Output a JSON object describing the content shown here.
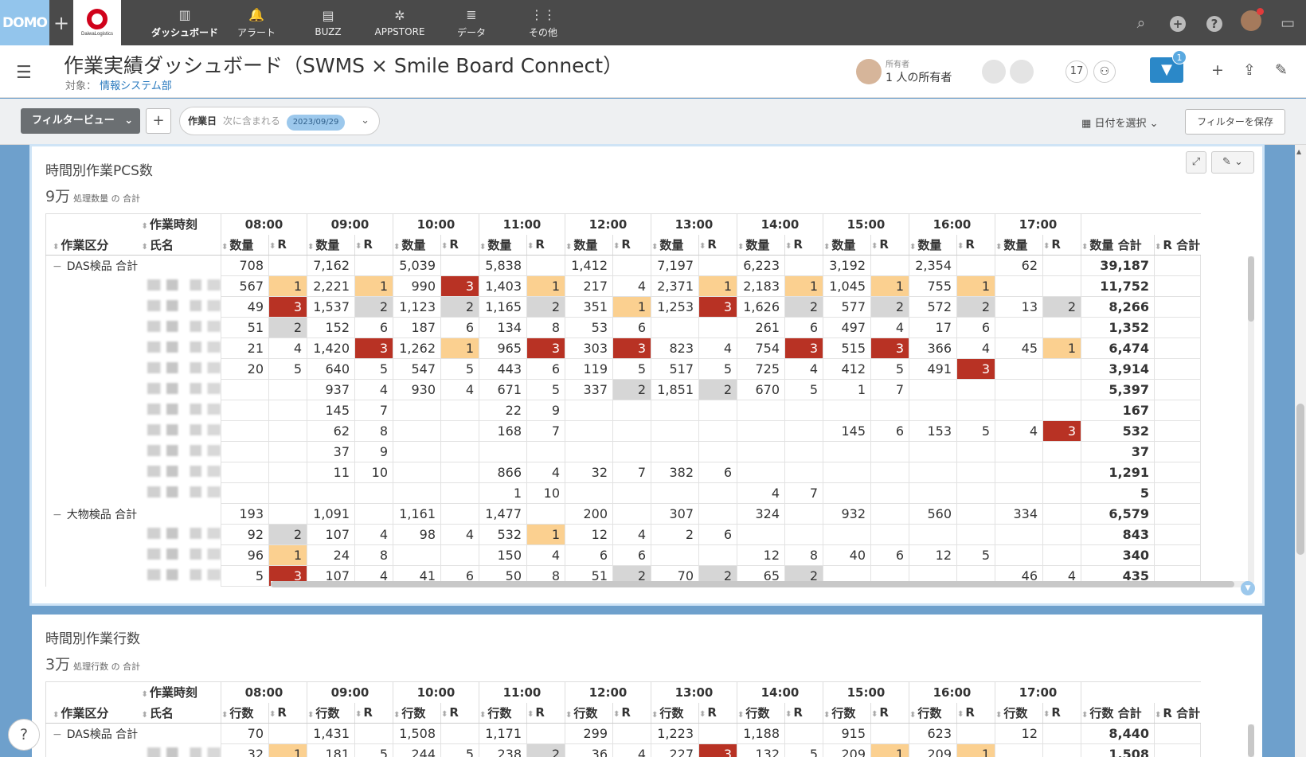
{
  "nav": {
    "logo": "DOMO",
    "brand": "DaiwaLogistics",
    "items": [
      {
        "label": "ダッシュボード",
        "icon": "dashboard-icon",
        "glyph": "▥"
      },
      {
        "label": "アラート",
        "icon": "bell-icon",
        "glyph": "🔔"
      },
      {
        "label": "BUZZ",
        "icon": "chat-icon",
        "glyph": "▤"
      },
      {
        "label": "APPSTORE",
        "icon": "appstore-icon",
        "glyph": "✲"
      },
      {
        "label": "データ",
        "icon": "database-icon",
        "glyph": "≣"
      },
      {
        "label": "その他",
        "icon": "grid-icon",
        "glyph": "⋮⋮"
      }
    ]
  },
  "header": {
    "title": "作業実績ダッシュボード（SWMS × Smile Board Connect）",
    "subtitle_prefix": "対象：",
    "subtitle_link": "情報システム部",
    "owner_label": "所有者",
    "owner_count": "1 人の所有者",
    "share_count": "17",
    "filter_badge": "1"
  },
  "filterbar": {
    "view_label": "フィルタービュー",
    "field": "作業日",
    "operator": "次に含まれる",
    "value": "2023/09/29",
    "date_select": "日付を選択",
    "save_filter": "フィルターを保存"
  },
  "card1": {
    "title": "時間別作業PCS数",
    "total": "9万",
    "total_sub": "処理数量 の 合計",
    "metric": "数量",
    "total_label": "数量 合計"
  },
  "card2": {
    "title": "時間別作業行数",
    "total": "3万",
    "total_sub": "処理行数 の 合計",
    "metric": "行数",
    "total_label": "行数 合計"
  },
  "table_common": {
    "time_header": "作業時刻",
    "category_header": "作業区分",
    "name_header": "氏名",
    "r_label": "R",
    "r_total_label": "R 合計",
    "hours": [
      "08:00",
      "09:00",
      "10:00",
      "11:00",
      "12:00",
      "13:00",
      "14:00",
      "15:00",
      "16:00",
      "17:00"
    ]
  },
  "colors": {
    "r1": "#fbd090",
    "r2": "#d6d6d6",
    "r3": "#b83224",
    "accent": "#2b88c8"
  },
  "table1_rows": [
    {
      "group": "DAS検品 合計",
      "cells": [
        [
          "708",
          ""
        ],
        [
          "7,162",
          ""
        ],
        [
          "5,039",
          ""
        ],
        [
          "5,838",
          ""
        ],
        [
          "1,412",
          ""
        ],
        [
          "7,197",
          ""
        ],
        [
          "6,223",
          ""
        ],
        [
          "3,192",
          ""
        ],
        [
          "2,354",
          ""
        ],
        [
          "62",
          ""
        ]
      ],
      "total": "39,187"
    },
    {
      "cells": [
        [
          "567",
          "1"
        ],
        [
          "2,221",
          "1"
        ],
        [
          "990",
          "3"
        ],
        [
          "1,403",
          "1"
        ],
        [
          "217",
          "4"
        ],
        [
          "2,371",
          "1"
        ],
        [
          "2,183",
          "1"
        ],
        [
          "1,045",
          "1"
        ],
        [
          "755",
          "1"
        ],
        [
          "",
          ""
        ]
      ],
      "total": "11,752"
    },
    {
      "cells": [
        [
          "49",
          "3"
        ],
        [
          "1,537",
          "2"
        ],
        [
          "1,123",
          "2"
        ],
        [
          "1,165",
          "2"
        ],
        [
          "351",
          "1"
        ],
        [
          "1,253",
          "3"
        ],
        [
          "1,626",
          "2"
        ],
        [
          "577",
          "2"
        ],
        [
          "572",
          "2"
        ],
        [
          "13",
          "2"
        ]
      ],
      "total": "8,266"
    },
    {
      "cells": [
        [
          "51",
          "2"
        ],
        [
          "152",
          "6"
        ],
        [
          "187",
          "6"
        ],
        [
          "134",
          "8"
        ],
        [
          "53",
          "6"
        ],
        [
          "",
          ""
        ],
        [
          "261",
          "6"
        ],
        [
          "497",
          "4"
        ],
        [
          "17",
          "6"
        ],
        [
          "",
          ""
        ]
      ],
      "total": "1,352"
    },
    {
      "cells": [
        [
          "21",
          "4"
        ],
        [
          "1,420",
          "3"
        ],
        [
          "1,262",
          "1"
        ],
        [
          "965",
          "3"
        ],
        [
          "303",
          "3"
        ],
        [
          "823",
          "4"
        ],
        [
          "754",
          "3"
        ],
        [
          "515",
          "3"
        ],
        [
          "366",
          "4"
        ],
        [
          "45",
          "1"
        ]
      ],
      "total": "6,474"
    },
    {
      "cells": [
        [
          "20",
          "5"
        ],
        [
          "640",
          "5"
        ],
        [
          "547",
          "5"
        ],
        [
          "443",
          "6"
        ],
        [
          "119",
          "5"
        ],
        [
          "517",
          "5"
        ],
        [
          "725",
          "4"
        ],
        [
          "412",
          "5"
        ],
        [
          "491",
          "3"
        ],
        [
          "",
          ""
        ]
      ],
      "total": "3,914"
    },
    {
      "cells": [
        [
          "",
          ""
        ],
        [
          "937",
          "4"
        ],
        [
          "930",
          "4"
        ],
        [
          "671",
          "5"
        ],
        [
          "337",
          "2"
        ],
        [
          "1,851",
          "2"
        ],
        [
          "670",
          "5"
        ],
        [
          "1",
          "7"
        ],
        [
          "",
          ""
        ],
        [
          "",
          ""
        ]
      ],
      "total": "5,397"
    },
    {
      "cells": [
        [
          "",
          ""
        ],
        [
          "145",
          "7"
        ],
        [
          "",
          ""
        ],
        [
          "22",
          "9"
        ],
        [
          "",
          ""
        ],
        [
          "",
          ""
        ],
        [
          "",
          ""
        ],
        [
          "",
          ""
        ],
        [
          "",
          ""
        ],
        [
          "",
          ""
        ]
      ],
      "total": "167"
    },
    {
      "cells": [
        [
          "",
          ""
        ],
        [
          "62",
          "8"
        ],
        [
          "",
          ""
        ],
        [
          "168",
          "7"
        ],
        [
          "",
          ""
        ],
        [
          "",
          ""
        ],
        [
          "",
          ""
        ],
        [
          "145",
          "6"
        ],
        [
          "153",
          "5"
        ],
        [
          "4",
          "3"
        ]
      ],
      "total": "532"
    },
    {
      "cells": [
        [
          "",
          ""
        ],
        [
          "37",
          "9"
        ],
        [
          "",
          ""
        ],
        [
          "",
          ""
        ],
        [
          "",
          ""
        ],
        [
          "",
          ""
        ],
        [
          "",
          ""
        ],
        [
          "",
          ""
        ],
        [
          "",
          ""
        ],
        [
          "",
          ""
        ]
      ],
      "total": "37"
    },
    {
      "cells": [
        [
          "",
          ""
        ],
        [
          "11",
          "10"
        ],
        [
          "",
          ""
        ],
        [
          "866",
          "4"
        ],
        [
          "32",
          "7"
        ],
        [
          "382",
          "6"
        ],
        [
          "",
          ""
        ],
        [
          "",
          ""
        ],
        [
          "",
          ""
        ],
        [
          "",
          ""
        ]
      ],
      "total": "1,291"
    },
    {
      "cells": [
        [
          "",
          ""
        ],
        [
          "",
          ""
        ],
        [
          "",
          ""
        ],
        [
          "1",
          "10"
        ],
        [
          "",
          ""
        ],
        [
          "",
          ""
        ],
        [
          "4",
          "7"
        ],
        [
          "",
          ""
        ],
        [
          "",
          ""
        ],
        [
          "",
          ""
        ]
      ],
      "total": "5"
    },
    {
      "group": "大物検品 合計",
      "cells": [
        [
          "193",
          ""
        ],
        [
          "1,091",
          ""
        ],
        [
          "1,161",
          ""
        ],
        [
          "1,477",
          ""
        ],
        [
          "200",
          ""
        ],
        [
          "307",
          ""
        ],
        [
          "324",
          ""
        ],
        [
          "932",
          ""
        ],
        [
          "560",
          ""
        ],
        [
          "334",
          ""
        ]
      ],
      "total": "6,579"
    },
    {
      "cells": [
        [
          "92",
          "2"
        ],
        [
          "107",
          "4"
        ],
        [
          "98",
          "4"
        ],
        [
          "532",
          "1"
        ],
        [
          "12",
          "4"
        ],
        [
          "2",
          "6"
        ],
        [
          "",
          ""
        ],
        [
          "",
          ""
        ],
        [
          "",
          ""
        ],
        [
          "",
          ""
        ]
      ],
      "total": "843"
    },
    {
      "cells": [
        [
          "96",
          "1"
        ],
        [
          "24",
          "8"
        ],
        [
          "",
          ""
        ],
        [
          "150",
          "4"
        ],
        [
          "6",
          "6"
        ],
        [
          "",
          ""
        ],
        [
          "12",
          "8"
        ],
        [
          "40",
          "6"
        ],
        [
          "12",
          "5"
        ],
        [
          "",
          ""
        ]
      ],
      "total": "340"
    },
    {
      "cells": [
        [
          "5",
          "3"
        ],
        [
          "107",
          "4"
        ],
        [
          "41",
          "6"
        ],
        [
          "50",
          "8"
        ],
        [
          "51",
          "2"
        ],
        [
          "70",
          "2"
        ],
        [
          "65",
          "2"
        ],
        [
          "",
          ""
        ],
        [
          "",
          ""
        ],
        [
          "46",
          "4"
        ]
      ],
      "total": "435"
    }
  ],
  "table2_rows": [
    {
      "group": "DAS検品 合計",
      "cells": [
        [
          "70",
          ""
        ],
        [
          "1,431",
          ""
        ],
        [
          "1,508",
          ""
        ],
        [
          "1,171",
          ""
        ],
        [
          "299",
          ""
        ],
        [
          "1,223",
          ""
        ],
        [
          "1,188",
          ""
        ],
        [
          "915",
          ""
        ],
        [
          "623",
          ""
        ],
        [
          "12",
          ""
        ]
      ],
      "total": "8,440"
    },
    {
      "cells": [
        [
          "32",
          "1"
        ],
        [
          "181",
          "5"
        ],
        [
          "244",
          "5"
        ],
        [
          "238",
          "2"
        ],
        [
          "36",
          "4"
        ],
        [
          "227",
          "3"
        ],
        [
          "132",
          "5"
        ],
        [
          "209",
          "1"
        ],
        [
          "209",
          "1"
        ],
        [
          "",
          ""
        ]
      ],
      "total": "1,508"
    }
  ]
}
